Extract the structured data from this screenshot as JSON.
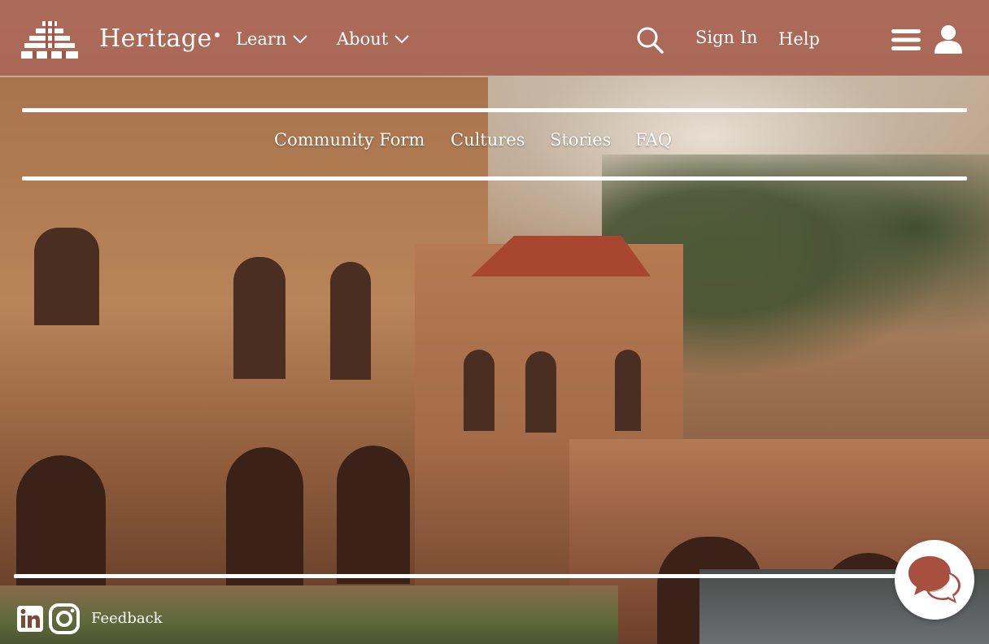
{
  "header": {
    "brand": "Heritage",
    "nav": [
      {
        "label": "Learn"
      },
      {
        "label": "About"
      }
    ],
    "signin_label": "Sign In",
    "help_label": "Help"
  },
  "subnav": {
    "items": [
      {
        "label": "Community Form"
      },
      {
        "label": "Cultures"
      },
      {
        "label": "Stories"
      },
      {
        "label": "FAQ"
      }
    ]
  },
  "footer": {
    "feedback_label": "Feedback"
  },
  "icons": {
    "logo": "temple-logo-icon",
    "search": "search-icon",
    "menu": "hamburger-menu-icon",
    "user": "user-icon",
    "linkedin": "linkedin-icon",
    "instagram": "instagram-icon",
    "chat": "chat-bubble-icon"
  },
  "colors": {
    "header_bg": "#a45444",
    "chat_icon": "#a8503f",
    "text": "#ffffff"
  }
}
